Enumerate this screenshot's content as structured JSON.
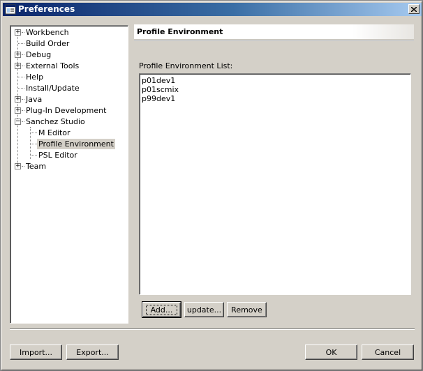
{
  "window": {
    "title": "Preferences"
  },
  "tree": {
    "items": [
      {
        "label": "Workbench",
        "expander": "+"
      },
      {
        "label": "Build Order",
        "expander": ""
      },
      {
        "label": "Debug",
        "expander": "+"
      },
      {
        "label": "External Tools",
        "expander": "+"
      },
      {
        "label": "Help",
        "expander": ""
      },
      {
        "label": "Install/Update",
        "expander": ""
      },
      {
        "label": "Java",
        "expander": "+"
      },
      {
        "label": "Plug-In Development",
        "expander": "+"
      },
      {
        "label": "Sanchez Studio",
        "expander": "−"
      },
      {
        "label": "M Editor",
        "expander": ""
      },
      {
        "label": "Profile Environment",
        "expander": "",
        "selected": true
      },
      {
        "label": "PSL Editor",
        "expander": ""
      },
      {
        "label": "Team",
        "expander": "+"
      }
    ]
  },
  "page": {
    "title": "Profile Environment",
    "list_label": "Profile Environment List:",
    "list_items": [
      "p01dev1",
      "p01scmix",
      "p99dev1"
    ],
    "buttons": {
      "add": "Add...",
      "update": "update...",
      "remove": "Remove"
    }
  },
  "footer": {
    "import": "Import...",
    "export": "Export...",
    "ok": "OK",
    "cancel": "Cancel"
  }
}
